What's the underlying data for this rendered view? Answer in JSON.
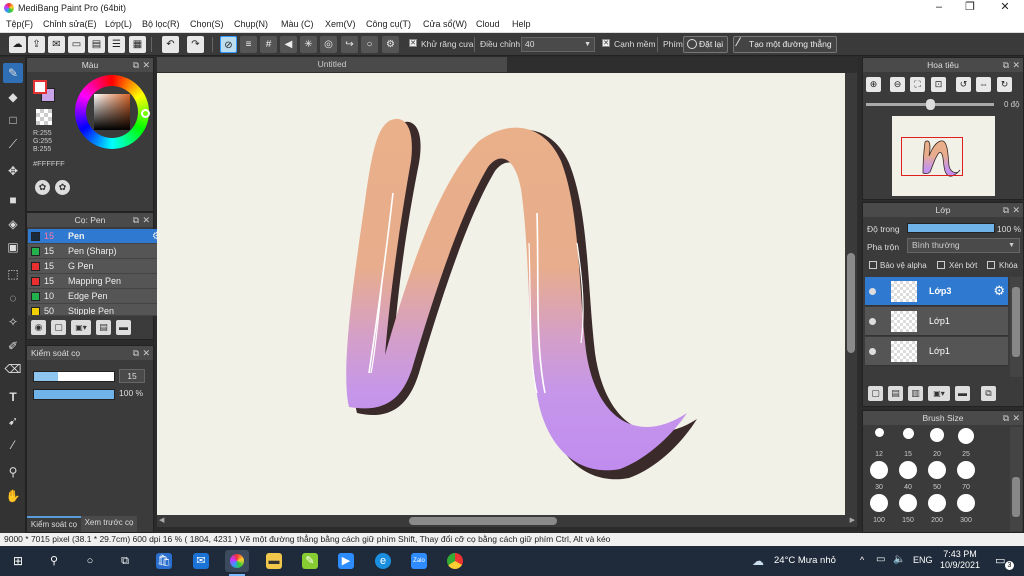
{
  "window": {
    "title": "MediBang Paint Pro (64bit)"
  },
  "menu": [
    "Tệp(F)",
    "Chỉnh sửa(E)",
    "Lớp(L)",
    "Bộ lọc(R)",
    "Chọn(S)",
    "Chụp(N)",
    "Màu (C)",
    "Xem(V)",
    "Công cụ(T)",
    "Cửa sổ(W)",
    "Cloud",
    "Help"
  ],
  "toolbar": {
    "antialias_label": "Khử răng cưa",
    "adjust_label": "Điều chỉnh",
    "adjust_value": "40",
    "edge_label": "Cạnh mềm",
    "key_label": "Phím",
    "reset_label": "Đặt lại",
    "straight_line_label": "Tạo một đường thẳng"
  },
  "color_panel": {
    "title": "Màu",
    "r": "R:255",
    "g": "G:255",
    "b": "B:255",
    "hex": "#FFFFFF",
    "primary": "#e33333",
    "secondary": "#c9a4e8"
  },
  "brush_panel": {
    "title": "Cọ: Pen",
    "items": [
      {
        "size": "15",
        "name": "Pen",
        "color": "#1b2a3a",
        "selected": true
      },
      {
        "size": "15",
        "name": "Pen (Sharp)",
        "color": "#22b14c"
      },
      {
        "size": "15",
        "name": "G Pen",
        "color": "#e83030"
      },
      {
        "size": "15",
        "name": "Mapping Pen",
        "color": "#e83030"
      },
      {
        "size": "10",
        "name": "Edge Pen",
        "color": "#22b14c"
      },
      {
        "size": "50",
        "name": "Stipple Pen",
        "color": "#f0d000"
      }
    ]
  },
  "brush_control": {
    "title": "Kiểm soát cọ",
    "size_value": "15",
    "size_fill": 0.3,
    "opacity_value": "100 %",
    "opacity_fill": 1.0,
    "tab1": "Kiểm soát cọ",
    "tab2": "Xem trước cọ"
  },
  "canvas": {
    "tab_title": "Untitled"
  },
  "navigator": {
    "title": "Hoa tiêu",
    "rotation": "0 độ"
  },
  "layer_panel": {
    "title": "Lớp",
    "opacity_label": "Độ trong",
    "opacity_value": "100 %",
    "opacity_fill": 1.0,
    "blend_label": "Pha trộn",
    "blend_value": "Bình thường",
    "protect_alpha": "Bảo vệ alpha",
    "clipping": "Xén bớt",
    "lock": "Khóa",
    "layers": [
      {
        "name": "Lớp3",
        "selected": true
      },
      {
        "name": "Lớp1"
      },
      {
        "name": "Lớp1"
      }
    ]
  },
  "brush_size_panel": {
    "title": "Brush Size",
    "sizes": [
      "12",
      "15",
      "20",
      "25",
      "30",
      "40",
      "50",
      "70",
      "100",
      "150",
      "200",
      "300"
    ]
  },
  "status": {
    "text": "9000 * 7015 pixel   (38.1 * 29.7cm)   600 dpi   16 %   ( 1804, 4231 )   Vẽ một đường thẳng bằng cách giữ phím Shift, Thay đổi cỡ cọ bằng cách giữ phím Ctrl, Alt và kéo"
  },
  "taskbar": {
    "weather": "24°C  Mưa nhỏ",
    "lang": "ENG",
    "time": "7:43 PM",
    "date": "10/9/2021",
    "notif": "3"
  }
}
